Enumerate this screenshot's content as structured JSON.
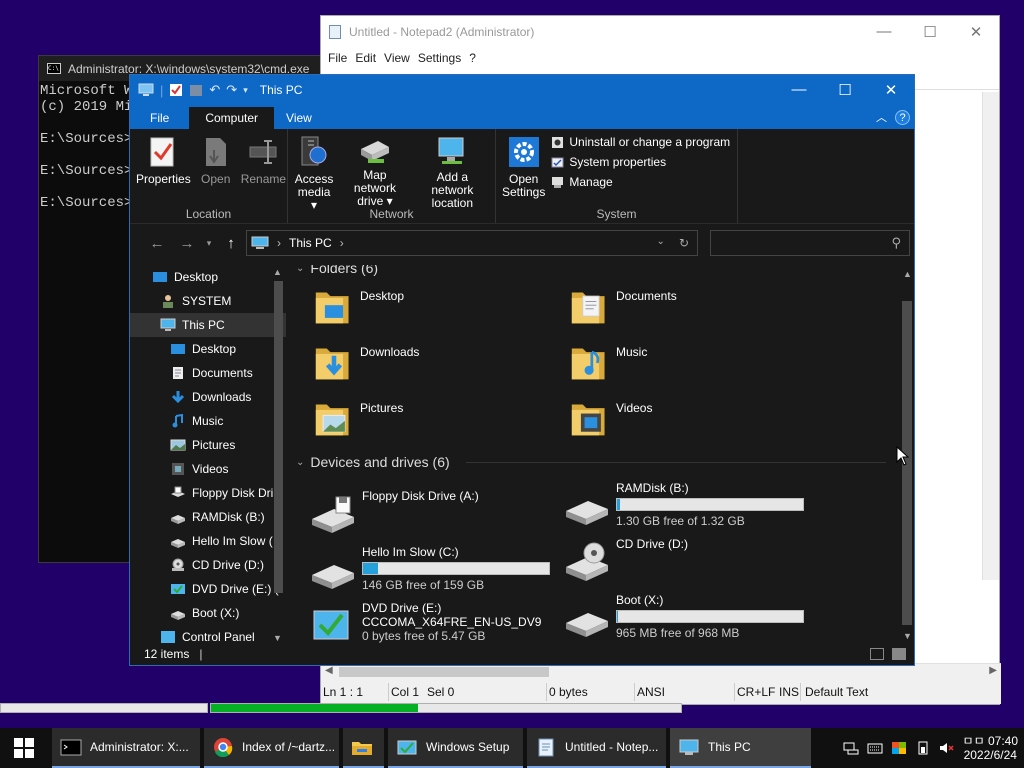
{
  "cmd": {
    "title": "Administrator: X:\\windows\\system32\\cmd.exe",
    "lines": [
      "Microsoft W",
      "(c) 2019 Mic",
      "",
      "E:\\Sources>",
      "",
      "E:\\Sources>",
      "",
      "E:\\Sources>"
    ]
  },
  "notepad": {
    "title": "Untitled - Notepad2 (Administrator)",
    "menu": [
      "File",
      "Edit",
      "View",
      "Settings",
      "?"
    ],
    "status": {
      "position": "Ln 1 : 1",
      "col": "Col 1",
      "sel": "Sel 0",
      "size": "0 bytes",
      "encoding": "ANSI",
      "eol": "CR+LF",
      "mode": "INS",
      "scheme": "Default Text"
    }
  },
  "explorer": {
    "title": "This PC",
    "tabs": {
      "file": "File",
      "computer": "Computer",
      "view": "View"
    },
    "ribbon": {
      "location": {
        "label": "Location",
        "properties": "Properties",
        "open": "Open",
        "rename": "Rename"
      },
      "network": {
        "label": "Network",
        "access_media": "Access",
        "access_media_2": "media ▾",
        "map_drive": "Map network",
        "map_drive_2": "drive ▾",
        "add_location": "Add a network",
        "add_location_2": "location"
      },
      "system": {
        "label": "System",
        "open_settings": "Open",
        "open_settings_2": "Settings",
        "uninstall": "Uninstall or change a program",
        "system_properties": "System properties",
        "manage": "Manage"
      }
    },
    "address": {
      "path": "This PC"
    },
    "nav": [
      {
        "label": "Desktop",
        "indent": 0
      },
      {
        "label": "SYSTEM",
        "indent": 1
      },
      {
        "label": "This PC",
        "indent": 1
      },
      {
        "label": "Desktop",
        "indent": 2
      },
      {
        "label": "Documents",
        "indent": 2
      },
      {
        "label": "Downloads",
        "indent": 2
      },
      {
        "label": "Music",
        "indent": 2
      },
      {
        "label": "Pictures",
        "indent": 2
      },
      {
        "label": "Videos",
        "indent": 2
      },
      {
        "label": "Floppy Disk Dri",
        "indent": 2
      },
      {
        "label": "RAMDisk (B:)",
        "indent": 2
      },
      {
        "label": "Hello Im Slow (",
        "indent": 2
      },
      {
        "label": "CD Drive (D:)",
        "indent": 2
      },
      {
        "label": "DVD Drive (E:) (",
        "indent": 2
      },
      {
        "label": "Boot (X:)",
        "indent": 2
      },
      {
        "label": "Control Panel",
        "indent": 1
      }
    ],
    "folders_header": "Folders (6)",
    "folders": [
      "Desktop",
      "Documents",
      "Downloads",
      "Music",
      "Pictures",
      "Videos"
    ],
    "drives_header": "Devices and drives (6)",
    "drives": [
      {
        "name": "Floppy Disk Drive (A:)",
        "sub": "",
        "fraction": null
      },
      {
        "name": "RAMDisk (B:)",
        "sub": "1.30 GB free of 1.32 GB",
        "fraction": 0.015
      },
      {
        "name": "Hello Im Slow (C:)",
        "sub": "146 GB free of 159 GB",
        "fraction": 0.08
      },
      {
        "name": "CD Drive (D:)",
        "sub": "",
        "fraction": null
      },
      {
        "name": "DVD Drive (E:)",
        "name2": "CCCOMA_X64FRE_EN-US_DV9",
        "sub": "0 bytes free of 5.47 GB",
        "fraction": null
      },
      {
        "name": "Boot (X:)",
        "sub": "965 MB free of 968 MB",
        "fraction": 0.003
      }
    ],
    "status": "12 items"
  },
  "progress": [
    0.0,
    0.44
  ],
  "taskbar": {
    "items": [
      "Administrator: X:...",
      "Index of /~dartz...",
      "",
      "Windows Setup",
      "Untitled - Notep...",
      "This PC"
    ],
    "time": "07:40",
    "time_prefix": "ㅁㅁ",
    "date": "2022/6/24"
  },
  "colors": {
    "accent": "#0d68c6",
    "progress": "#06b025",
    "drive_bar": "#26a0da",
    "desktop": "#22006a"
  }
}
